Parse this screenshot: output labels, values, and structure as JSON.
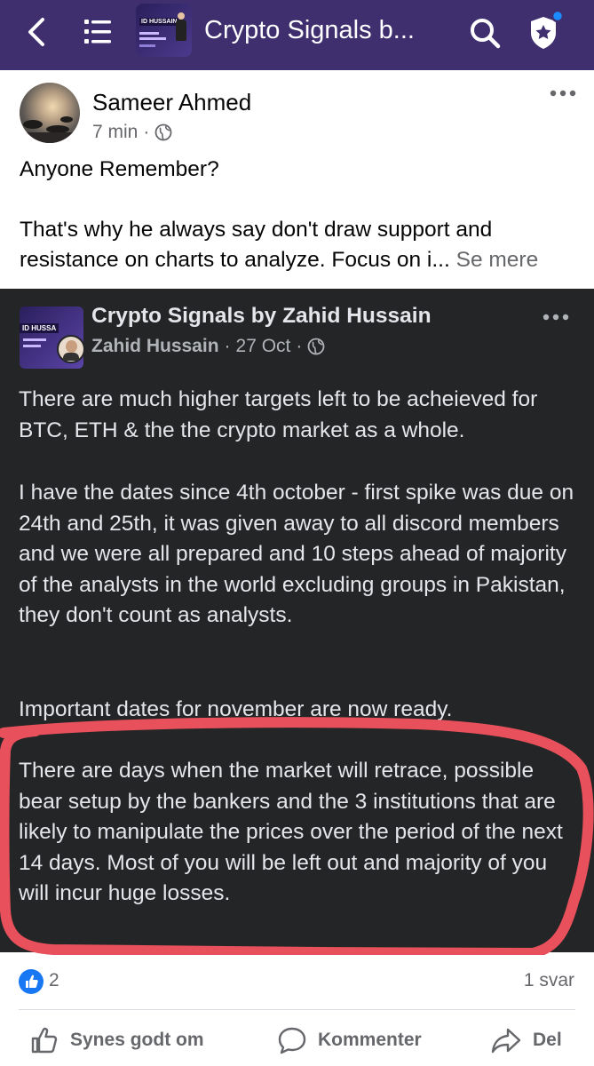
{
  "topbar": {
    "title": "Crypto Signals b...",
    "thumb_label": "ID HUSSAIN"
  },
  "post": {
    "author": "Sameer Ahmed",
    "time": "7 min",
    "separator": "·",
    "text_line1": "Anyone Remember?",
    "text_para2": "That's why he always say don't draw support and resistance on charts to analyze. Focus on i...",
    "see_more": "Se mere"
  },
  "shared": {
    "group_name": "Crypto Signals by Zahid Hussain",
    "thumb_label": "ID HUSSA",
    "poster": "Zahid Hussain",
    "date": "27 Oct",
    "separator": "·",
    "para1": "There are much higher targets left to be acheieved for BTC, ETH & the the crypto market as a whole.",
    "para2": "I have the dates since 4th october - first spike was due on 24th and 25th, it was given away to all discord members and we were all prepared and 10 steps ahead of majority of the analysts in the world excluding groups in Pakistan, they don't count as analysts.",
    "para3": "Important dates for november are now ready.",
    "para4": "There are days when the market will retrace, possible bear setup by the bankers and the 3 institutions that are likely to manipulate the prices over the period of the next 14 days. Most of you will be left out and majority of you will incur huge losses."
  },
  "reactions": {
    "count": "2",
    "replies": "1 svar"
  },
  "actions": {
    "like": "Synes godt om",
    "comment": "Kommenter",
    "share": "Del"
  },
  "colors": {
    "topbar": "#3f2f6f",
    "shared_bg": "#242526",
    "highlight": "#e8505b",
    "like_blue": "#1877f2"
  }
}
